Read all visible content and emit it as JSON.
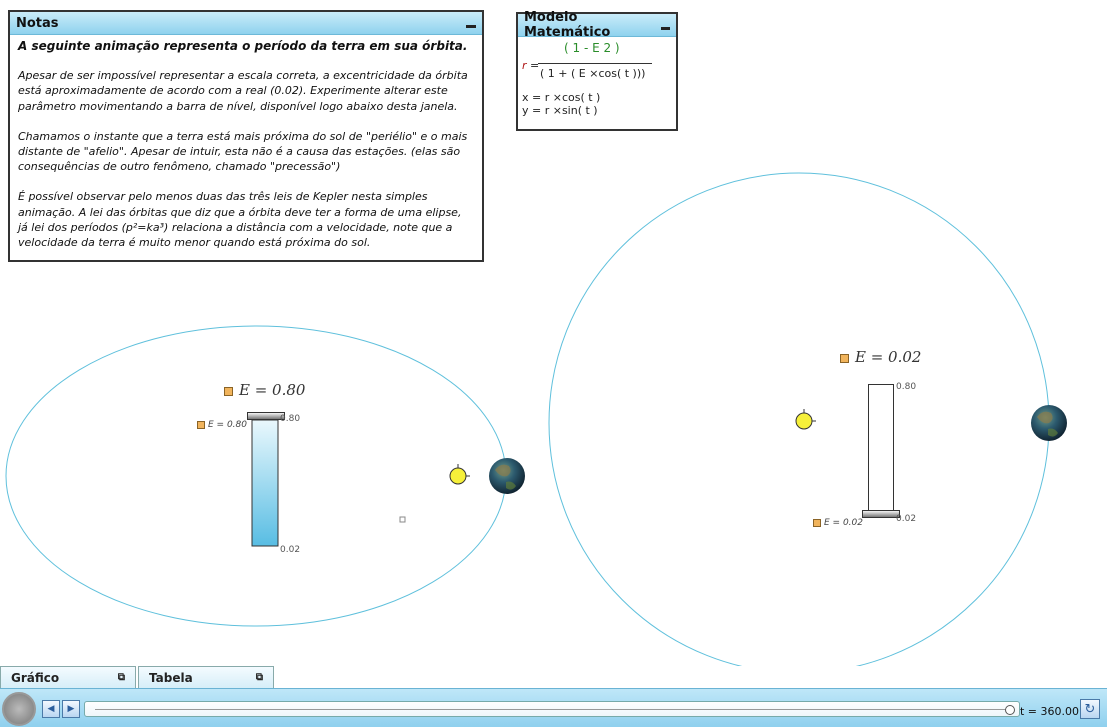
{
  "notes": {
    "title": "Notas",
    "lead": "A seguinte animação representa o período da terra em sua órbita.",
    "p1": "Apesar de ser impossível representar a escala correta, a excentricidade da órbita está aproximadamente de acordo com a real (0.02). Experimente alterar este parâmetro movimentando a barra de nível, disponível logo abaixo desta janela.",
    "p2": "Chamamos o instante que a terra está mais próxima do sol de \"periélio\" e o mais distante de \"afelio\". Apesar de intuir, esta não é a causa das estações. (elas são consequências de outro fenômeno, chamado \"precessão\")",
    "p3": "É possível observar pelo menos duas das três leis de Kepler nesta simples animação. A lei das órbitas que diz que a órbita deve ter a forma de uma elipse, já lei dos períodos (p²=ka³) relaciona a distância com a velocidade, note que a velocidade da terra é muito menor quando está próxima do sol."
  },
  "model": {
    "title": "Modelo Matemático",
    "r_label": "r",
    "numerator": "( 1 - E 2 )",
    "denominator": "( 1 + ( E ×cos( t )))",
    "x_eq": "x = r ×cos( t )",
    "y_eq": "y = r ×sin( t )"
  },
  "left_sim": {
    "e_label": "E = 0.80",
    "e_value": 0.8,
    "slider_label": "E = 0.80",
    "tick_max": "0.80",
    "tick_min": "0.02",
    "fill_fraction": 1.0
  },
  "right_sim": {
    "e_label": "E = 0.02",
    "e_value": 0.02,
    "slider_label": "E = 0.02",
    "tick_max": "0.80",
    "tick_min": "0.02",
    "fill_fraction": 0.0
  },
  "tabs": [
    {
      "label": "Gráfico"
    },
    {
      "label": "Tabela"
    }
  ],
  "toolbar": {
    "t_readout": "t  = 360.00",
    "t_value": 360.0
  },
  "colors": {
    "orbit": "#5fc0dc",
    "sun": "#f6f03a",
    "slider_fill": "#58bde3"
  },
  "icons": {
    "play": "play-circle-icon",
    "back": "step-back-icon",
    "forward": "step-forward-icon",
    "refresh": "refresh-icon",
    "restore": "restore-window-icon"
  }
}
